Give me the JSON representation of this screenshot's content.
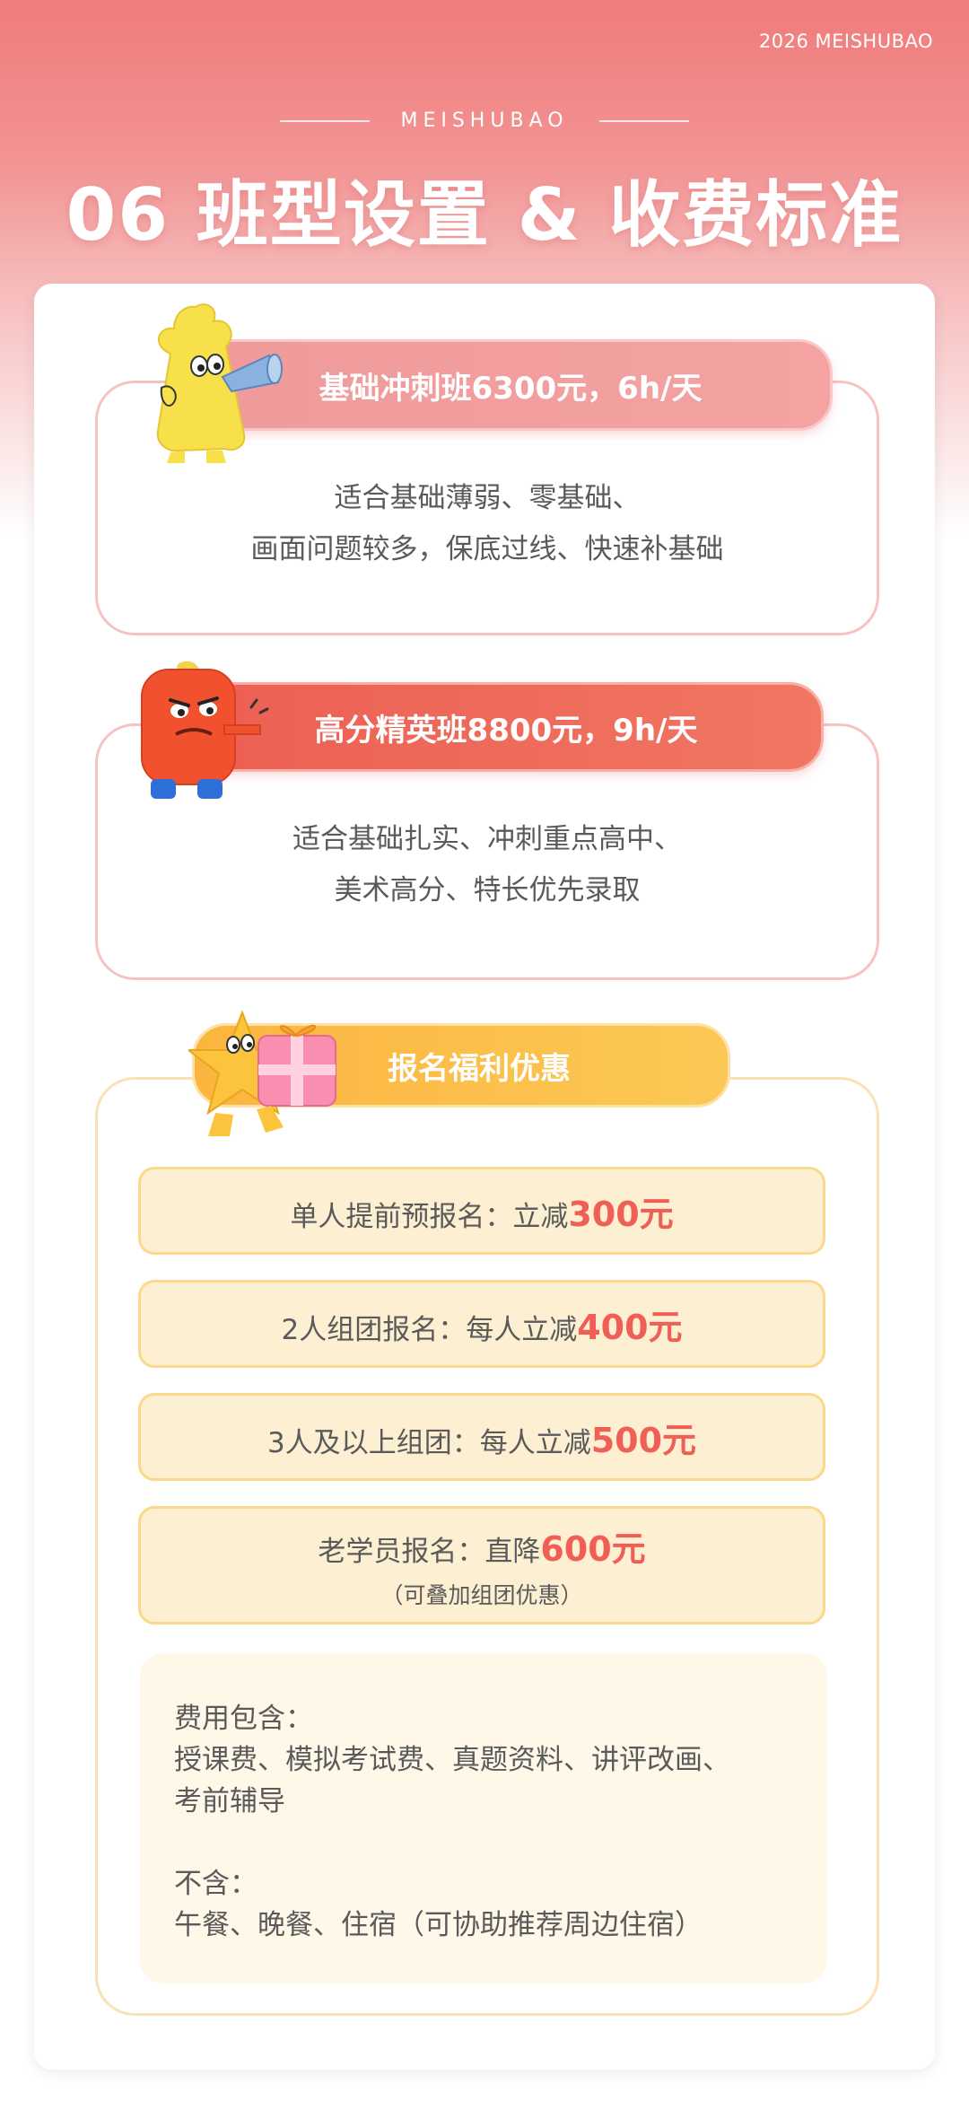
{
  "header": {
    "corner": "2026 MEISHUBAO",
    "brand": "MEISHUBAO",
    "title": "06 班型设置 & 收费标准"
  },
  "classes": [
    {
      "label": "基础冲刺班6300元，6h/天",
      "line1": "适合基础薄弱、零基础、",
      "line2": "画面问题较多，保底过线、快速补基础"
    },
    {
      "label": "高分精英班8800元，9h/天",
      "line1": "适合基础扎实、冲刺重点高中、",
      "line2": "美术高分、特长优先录取"
    }
  ],
  "benefits": {
    "label": "报名福利优惠",
    "items": [
      {
        "text": "单人提前预报名：立减",
        "amount": "300元"
      },
      {
        "text": "2人组团报名：每人立减",
        "amount": "400元"
      },
      {
        "text": "3人及以上组团：每人立减",
        "amount": "500元"
      },
      {
        "text": "老学员报名：直降",
        "amount": "600元",
        "note": "（可叠加组团优惠）"
      }
    ]
  },
  "fees": {
    "included_title": "费用包含：",
    "included": "授课费、模拟考试费、真题资料、讲评改画、",
    "included2": "考前辅导",
    "excluded_title": "不含：",
    "excluded": "午餐、晚餐、住宿（可协助推荐周边住宿）"
  },
  "colors": {
    "accent_pink": "#f09a9a",
    "accent_red": "#ec5f53",
    "accent_yellow": "#fbb53f",
    "highlight": "#ef5f56"
  }
}
